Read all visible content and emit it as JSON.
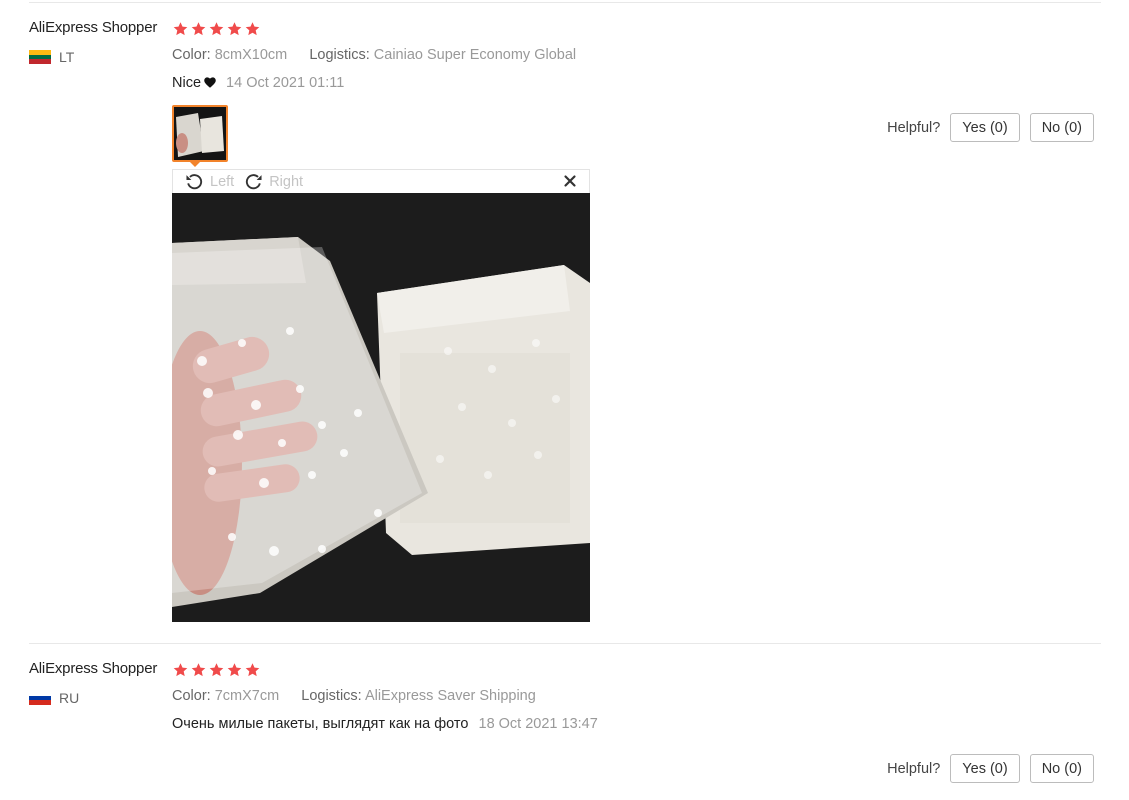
{
  "reviews": [
    {
      "username": "AliExpress Shopper",
      "rating": 5,
      "country": "LT",
      "flag_colors": [
        "#fdb913",
        "#006a44",
        "#c1272d"
      ],
      "color_label": "Color:",
      "color_value": "8cmX10cm",
      "logistics_label": "Logistics:",
      "logistics_value": "Cainiao Super Economy Global",
      "text": "Nice",
      "date": "14 Oct 2021 01:11",
      "helpful_label": "Helpful?",
      "yes_label": "Yes (0)",
      "no_label": "No (0)",
      "photo_alt": "photo of clear polka-dot plastic bags",
      "viewer": {
        "left_label": "Left",
        "right_label": "Right"
      }
    },
    {
      "username": "AliExpress Shopper",
      "rating": 5,
      "country": "RU",
      "flag_colors": [
        "#ffffff",
        "#0039a6",
        "#d52b1e"
      ],
      "color_label": "Color:",
      "color_value": "7cmX7cm",
      "logistics_label": "Logistics:",
      "logistics_value": "AliExpress Saver Shipping",
      "text": "Очень милые пакеты, выглядят как на фото",
      "date": "18 Oct 2021 13:47",
      "helpful_label": "Helpful?",
      "yes_label": "Yes (0)",
      "no_label": "No (0)"
    }
  ],
  "colors": {
    "star": "#f04b4b",
    "accent": "#f2832b"
  }
}
